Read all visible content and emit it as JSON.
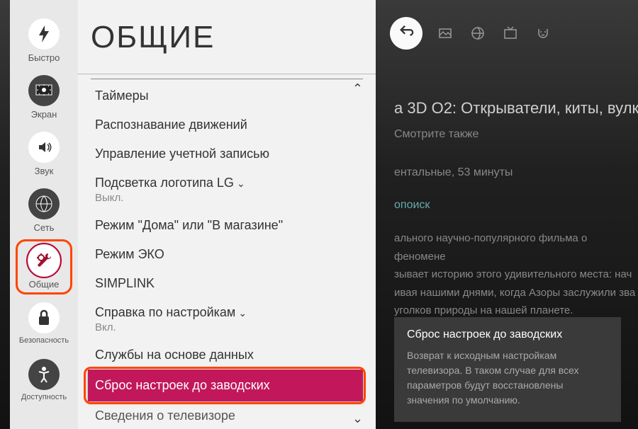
{
  "sidebar": {
    "items": [
      {
        "label": "Быстро",
        "icon": "bolt"
      },
      {
        "label": "Экран",
        "icon": "screen"
      },
      {
        "label": "Звук",
        "icon": "speaker"
      },
      {
        "label": "Сеть",
        "icon": "globe"
      },
      {
        "label": "Общие",
        "icon": "tools",
        "selected": true
      },
      {
        "label": "Безопасность",
        "icon": "lock"
      },
      {
        "label": "Доступность",
        "icon": "accessibility"
      }
    ]
  },
  "menu": {
    "title": "ОБЩИЕ",
    "items": [
      {
        "label": "Таймеры",
        "caret_up": true
      },
      {
        "label": "Распознавание движений"
      },
      {
        "label": "Управление учетной записью"
      },
      {
        "label": "Подсветка логотипа LG",
        "expand": true,
        "sub": "Выкл."
      },
      {
        "label": "Режим \"Дома\" или \"В магазине\""
      },
      {
        "label": "Режим ЭКО"
      },
      {
        "label": "SIMPLINK"
      },
      {
        "label": "Справка по настройкам",
        "expand": true,
        "sub": "Вкл."
      },
      {
        "label": "Службы на основе данных"
      },
      {
        "label": "Сброс настроек до заводских",
        "highlighted": true
      },
      {
        "label": "Сведения о телевизоре",
        "caret_down": true
      }
    ]
  },
  "background": {
    "title": "а 3D О2: Открыватели, киты, вулк",
    "see_also": "Смотрите также",
    "duration": "ентальные, 53 минуты",
    "search": "опоиск",
    "description": "ального научно-популярного фильма о феномене\nзывает историю этого удивительного места: нач\nивая нашими днями, когда Азоры заслужили зва\nуголков природы на нашей планете."
  },
  "tooltip": {
    "title": "Сброс настроек до заводских",
    "body": "Возврат к исходным настройкам телевизора. В таком случае для всех параметров будут восстановлены значения по умолчанию."
  },
  "top_icons": {
    "back": "back"
  }
}
